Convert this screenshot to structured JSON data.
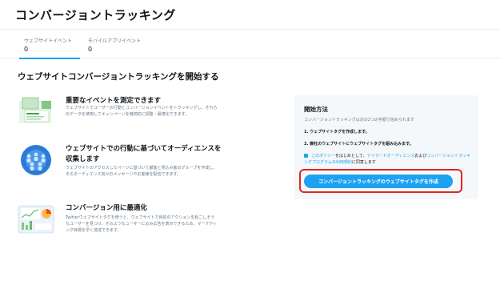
{
  "header": {
    "title": "コンバージョントラッキング"
  },
  "tabs": [
    {
      "label": "ウェブサイトイベント",
      "count": "0"
    },
    {
      "label": "モバイルアプリイベント",
      "count": "0"
    }
  ],
  "main": {
    "section_title": "ウェブサイトコンバージョントラッキングを開始する",
    "features": [
      {
        "title": "重要なイベントを測定できます",
        "desc": "ウェブサイトでユーザーの行動とコンバージョンイベントをトラッキングし、それらのデータを使用してキャンペーンを継続的に調整・最適化できます。",
        "icon": "analytics-cards-icon"
      },
      {
        "title": "ウェブサイトでの行動に基づいてオーディエンスを収集します",
        "desc": "ウェブサイトのアクセスしたページに基づいて顧客と見込み客のグループを作成し、そのオーディエンス向けのメッセージやお客様を配信できます。",
        "icon": "audience-group-icon"
      },
      {
        "title": "コンバージョン用に最適化",
        "desc": "Twitterウェブサイトタグを使うと、ウェブサイトで目的のアクションを起こしそうなユーザーを見つけ、そのようなユーザーにのみ広告を表示できるため、マーケティング目標を早く達成できます。",
        "icon": "chart-optimization-icon"
      }
    ]
  },
  "panel": {
    "title": "開始方法",
    "subtitle": "コンバージョントラッキングは次の2つの手順で始められます",
    "step1": "1. ウェブサイトタグを作成します。",
    "step2": "2. 御社のウェブサイトにウェブサイトタグを組み込みます。",
    "agree_link1": "このポリシー",
    "agree_text1": "をはじめとして、",
    "agree_link2": "テイラードオーディエンス",
    "agree_text2": "および",
    "agree_link3": "コンバージョントラッキングプログラムの利用規約",
    "agree_text3": "に同意します",
    "button_label": "コンバージョントラッキングのウェブサイトタグを作成"
  },
  "colors": {
    "accent": "#1da1f2",
    "highlight": "#e0261f"
  }
}
